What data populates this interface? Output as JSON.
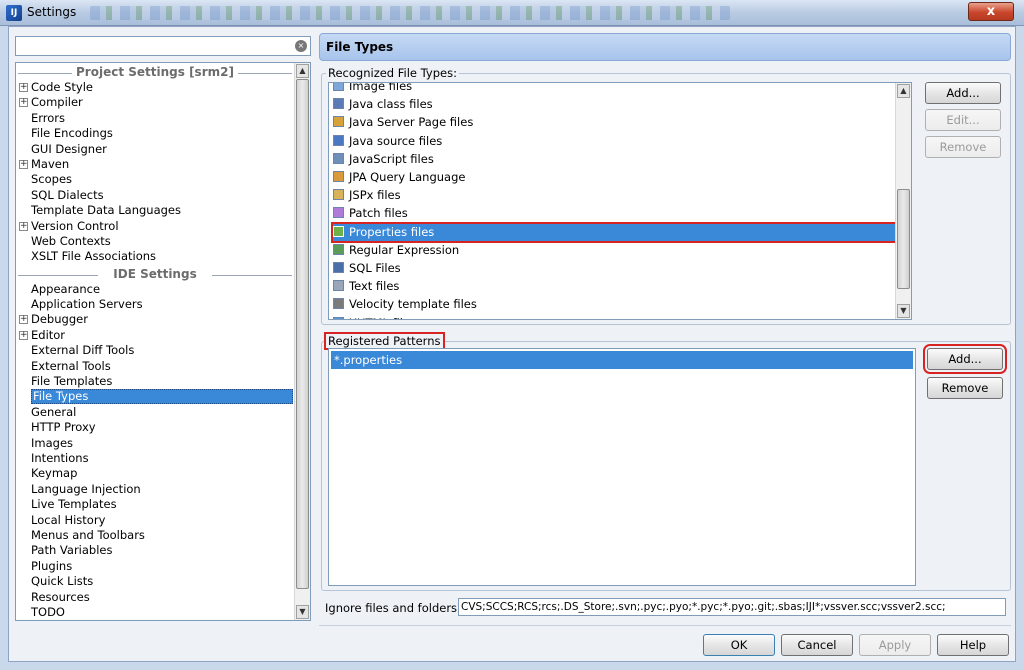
{
  "window": {
    "title": "Settings",
    "close": "x"
  },
  "search": {
    "value": "",
    "clear_icon": "×"
  },
  "tree": {
    "project_header": "Project Settings [srm2]",
    "project_items": [
      {
        "label": "Code Style",
        "expandable": true
      },
      {
        "label": "Compiler",
        "expandable": true
      },
      {
        "label": "Errors",
        "expandable": false
      },
      {
        "label": "File Encodings",
        "expandable": false
      },
      {
        "label": "GUI Designer",
        "expandable": false
      },
      {
        "label": "Maven",
        "expandable": true
      },
      {
        "label": "Scopes",
        "expandable": false
      },
      {
        "label": "SQL Dialects",
        "expandable": false
      },
      {
        "label": "Template Data Languages",
        "expandable": false
      },
      {
        "label": "Version Control",
        "expandable": true
      },
      {
        "label": "Web Contexts",
        "expandable": false
      },
      {
        "label": "XSLT File Associations",
        "expandable": false
      }
    ],
    "ide_header": "IDE Settings",
    "ide_items": [
      {
        "label": "Appearance",
        "expandable": false
      },
      {
        "label": "Application Servers",
        "expandable": false
      },
      {
        "label": "Debugger",
        "expandable": true
      },
      {
        "label": "Editor",
        "expandable": true
      },
      {
        "label": "External Diff Tools",
        "expandable": false
      },
      {
        "label": "External Tools",
        "expandable": false
      },
      {
        "label": "File Templates",
        "expandable": false
      },
      {
        "label": "File Types",
        "expandable": false,
        "selected": true
      },
      {
        "label": "General",
        "expandable": false
      },
      {
        "label": "HTTP Proxy",
        "expandable": false
      },
      {
        "label": "Images",
        "expandable": false
      },
      {
        "label": "Intentions",
        "expandable": false
      },
      {
        "label": "Keymap",
        "expandable": false
      },
      {
        "label": "Language Injection",
        "expandable": false
      },
      {
        "label": "Live Templates",
        "expandable": false
      },
      {
        "label": "Local History",
        "expandable": false
      },
      {
        "label": "Menus and Toolbars",
        "expandable": false
      },
      {
        "label": "Path Variables",
        "expandable": false
      },
      {
        "label": "Plugins",
        "expandable": false
      },
      {
        "label": "Quick Lists",
        "expandable": false
      },
      {
        "label": "Resources",
        "expandable": false
      },
      {
        "label": "TODO",
        "expandable": false
      }
    ]
  },
  "panel": {
    "title": "File Types",
    "recognized_label": "Recognized File Types:",
    "file_types": [
      {
        "label": "Image files",
        "icon": "image-file-icon",
        "color": "#7fa6d8"
      },
      {
        "label": "Java class files",
        "icon": "class-file-icon",
        "color": "#5a7bb5"
      },
      {
        "label": "Java Server Page files",
        "icon": "jsp-file-icon",
        "color": "#d8a23a"
      },
      {
        "label": "Java source files",
        "icon": "java-file-icon",
        "color": "#4a78c2"
      },
      {
        "label": "JavaScript files",
        "icon": "javascript-file-icon",
        "color": "#6f8fb8"
      },
      {
        "label": "JPA Query Language",
        "icon": "jpa-icon",
        "color": "#d89a3a"
      },
      {
        "label": "JSPx files",
        "icon": "jspx-file-icon",
        "color": "#d8b35a"
      },
      {
        "label": "Patch files",
        "icon": "patch-file-icon",
        "color": "#b07ad8"
      },
      {
        "label": "Properties files",
        "icon": "properties-file-icon",
        "color": "#6fb04a",
        "selected": true
      },
      {
        "label": "Regular Expression",
        "icon": "regex-icon",
        "color": "#5a9a5a"
      },
      {
        "label": "SQL Files",
        "icon": "sql-file-icon",
        "color": "#4a6fa8"
      },
      {
        "label": "Text files",
        "icon": "text-file-icon",
        "color": "#9aa7b8"
      },
      {
        "label": "Velocity template files",
        "icon": "velocity-file-icon",
        "color": "#7a7a7a"
      },
      {
        "label": "XHTML files",
        "icon": "xhtml-file-icon",
        "color": "#5a9ad8"
      }
    ],
    "file_buttons": {
      "add": "Add...",
      "edit": "Edit...",
      "remove": "Remove"
    },
    "patterns_label": "Registered Patterns",
    "patterns": [
      "*.properties"
    ],
    "pattern_buttons": {
      "add": "Add...",
      "remove": "Remove"
    },
    "ignore_label": "Ignore files and folders:",
    "ignore_value": "CVS;SCCS;RCS;rcs;.DS_Store;.svn;.pyc;.pyo;*.pyc;*.pyo;.git;.sbas;IJI*;vssver.scc;vssver2.scc;"
  },
  "dialog_buttons": {
    "ok": "OK",
    "cancel": "Cancel",
    "apply": "Apply",
    "help": "Help"
  },
  "colors": {
    "selection": "#3a88d8",
    "highlight": "#d82323",
    "header": "#a8c4ec"
  }
}
